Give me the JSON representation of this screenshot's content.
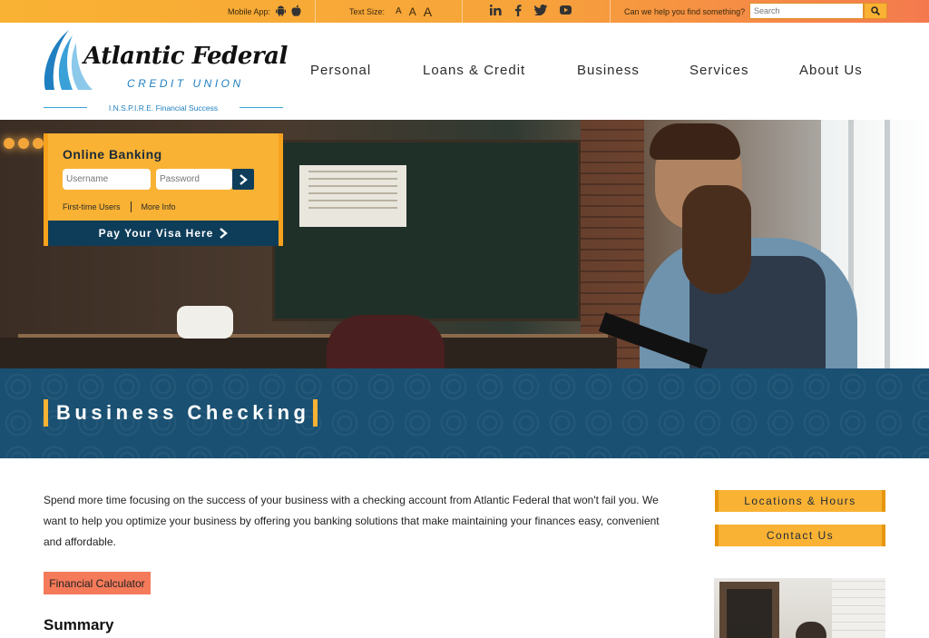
{
  "topbar": {
    "mobile_app_label": "Mobile App:",
    "mobile_apps": [
      "android-icon",
      "apple-icon"
    ],
    "text_size_label": "Text Size:",
    "text_sizes": [
      "A",
      "A",
      "A"
    ],
    "social": [
      "linkedin-icon",
      "facebook-icon",
      "twitter-icon",
      "youtube-icon"
    ],
    "help_label": "Can we help you find something?",
    "search_placeholder": "Search"
  },
  "logo": {
    "name": "Atlantic Federal",
    "subtitle": "CREDIT UNION",
    "tagline": "I.N.S.P.I.R.E. Financial Success"
  },
  "nav": {
    "items": [
      "Personal",
      "Loans & Credit",
      "Business",
      "Services",
      "About Us"
    ]
  },
  "online_banking": {
    "title": "Online Banking",
    "username_placeholder": "Username",
    "password_placeholder": "Password",
    "links": [
      "First-time Users",
      "More Info"
    ],
    "pay_label": "Pay Your Visa Here"
  },
  "banner": {
    "title": "Business Checking"
  },
  "content": {
    "intro": "Spend more time focusing on the success of your business with a checking account from Atlantic Federal that won't fail you. We want to help you optimize your business by offering you banking solutions that make maintaining your finances easy, convenient and affordable.",
    "calculator_label": "Financial Calculator",
    "summary_heading": "Summary"
  },
  "sidebar": {
    "buttons": [
      "Locations & Hours",
      "Contact Us"
    ]
  },
  "colors": {
    "accent_orange": "#f9b233",
    "coral": "#f47a5a",
    "navy": "#0e3d5a",
    "banner_blue": "#1a5072",
    "logo_blue": "#1f7fc0"
  }
}
